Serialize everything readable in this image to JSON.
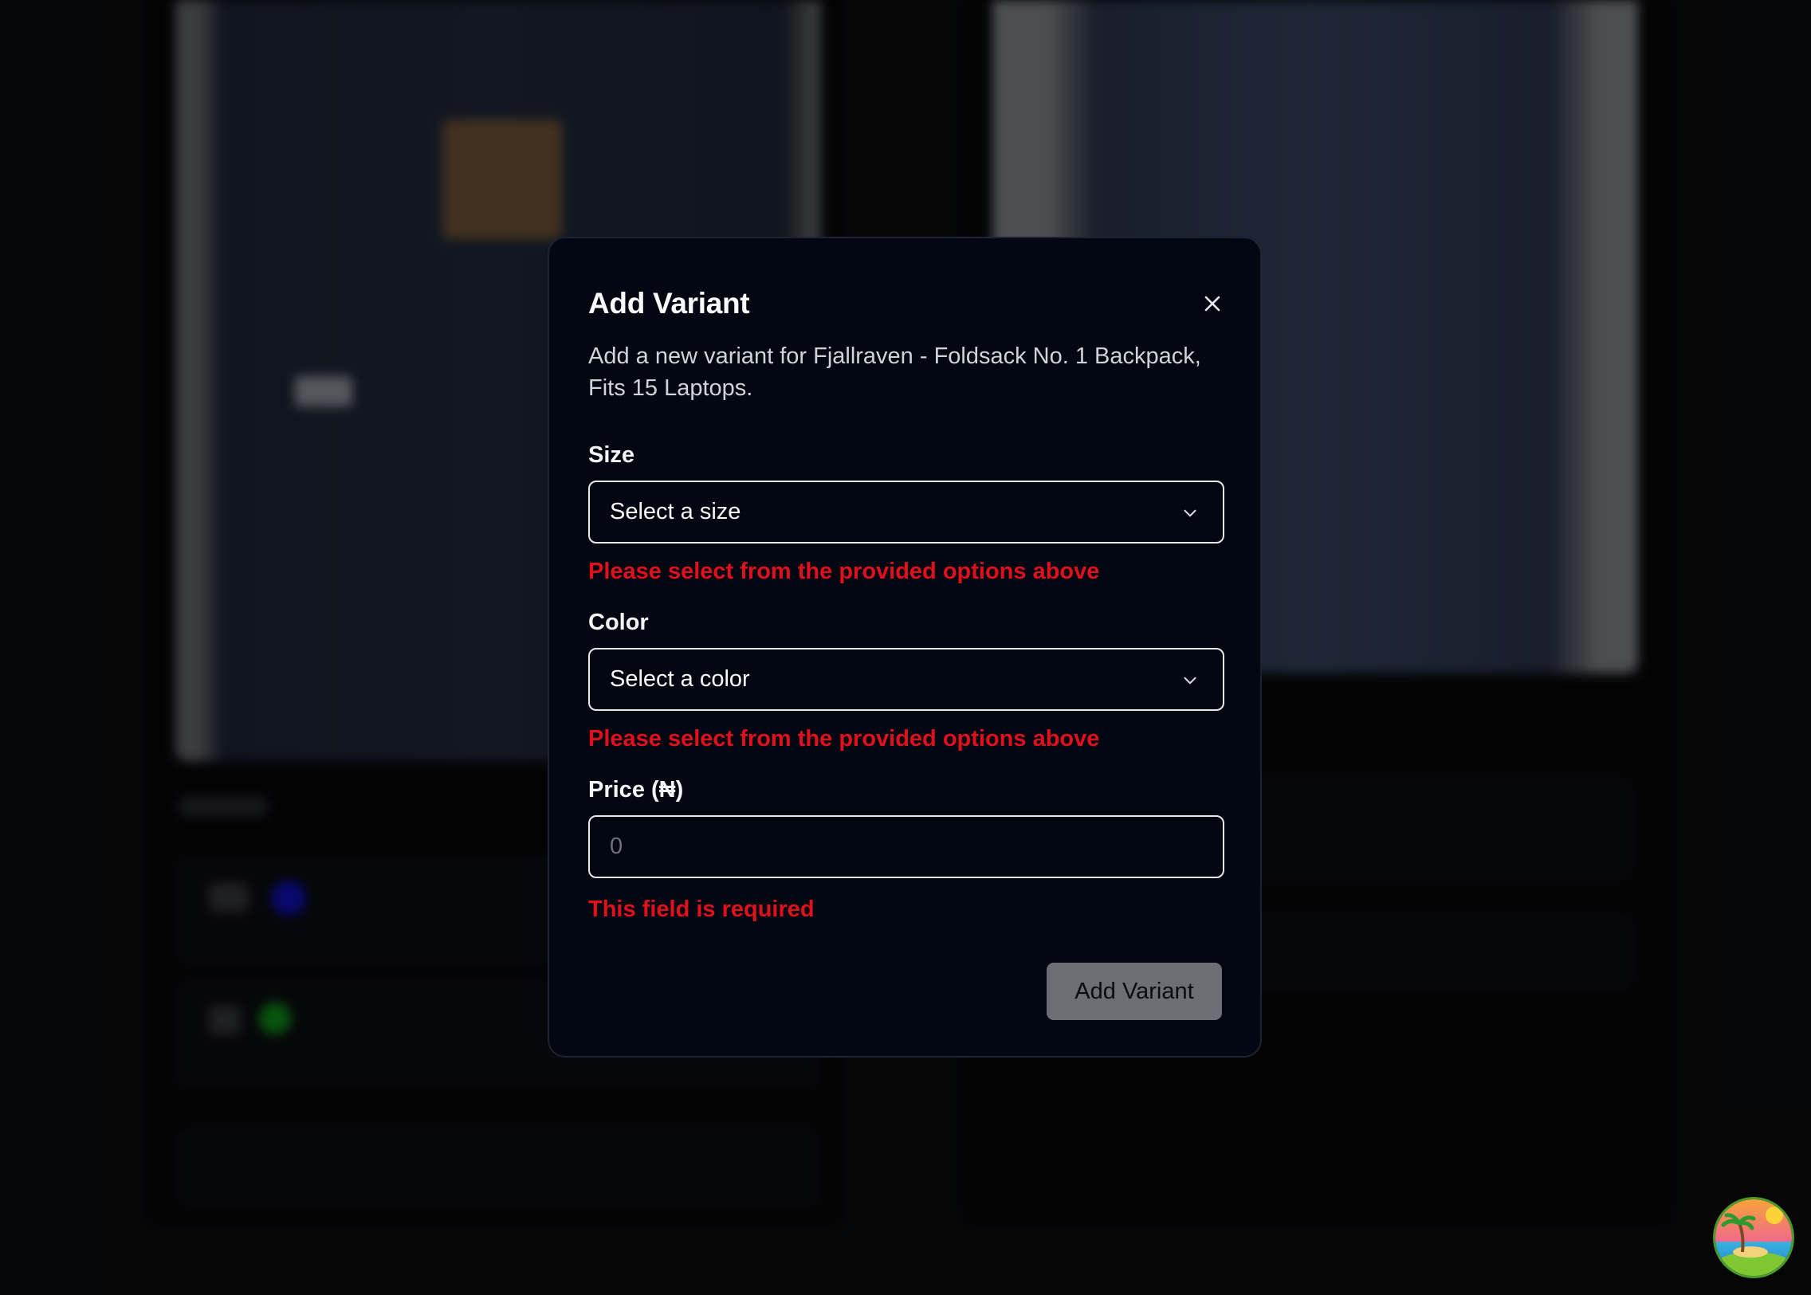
{
  "modal": {
    "title": "Add Variant",
    "description": "Add a new variant for Fjallraven - Foldsack No. 1 Backpack, Fits 15 Laptops.",
    "close_icon": "close-icon",
    "size": {
      "label": "Size",
      "placeholder": "Select a size",
      "error": "Please select from the provided options above"
    },
    "color": {
      "label": "Color",
      "placeholder": "Select a color",
      "error": "Please select from the provided options above"
    },
    "price": {
      "label": "Price (₦)",
      "placeholder": "0",
      "error": "This field is required"
    },
    "submit_label": "Add Variant"
  },
  "colors": {
    "modal_bg": "#030712",
    "error": "#e0101d",
    "button_disabled": "#6b6e75",
    "variant_blue": "#1010c8",
    "variant_green": "#0f9a1c"
  },
  "floating_button": {
    "icon": "island-avatar-icon"
  }
}
